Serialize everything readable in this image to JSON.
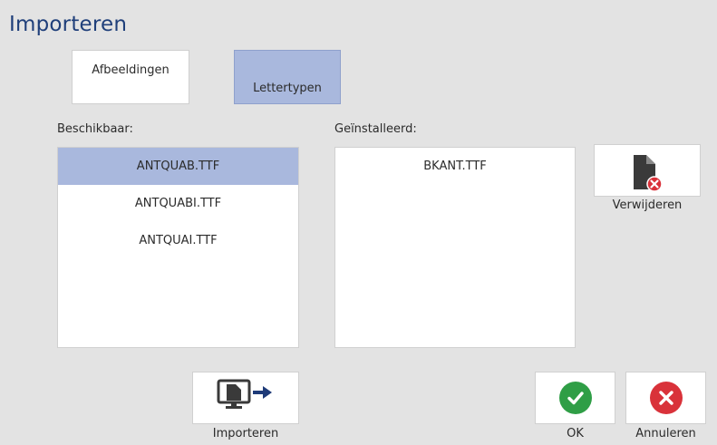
{
  "window": {
    "title": "Importeren"
  },
  "tabs": [
    {
      "label": "Afbeeldingen",
      "selected": false
    },
    {
      "label": "Lettertypen",
      "selected": true
    }
  ],
  "available": {
    "label": "Beschikbaar:",
    "items": [
      "ANTQUAB.TTF",
      "ANTQUABI.TTF",
      "ANTQUAI.TTF"
    ],
    "selected_index": 0
  },
  "installed": {
    "label": "Geïnstalleerd:",
    "items": [
      "BKANT.TTF"
    ]
  },
  "buttons": {
    "remove_label": "Verwijderen",
    "import_label": "Importeren",
    "ok_label": "OK",
    "cancel_label": "Annuleren"
  },
  "icons": {
    "remove": "file-remove-icon",
    "import": "monitor-import-icon",
    "ok": "checkmark-circle-icon",
    "cancel": "close-circle-icon"
  },
  "colors": {
    "title": "#1f3f7a",
    "selection": "#a9b8dd",
    "ok": "#2f9e46",
    "cancel": "#d9323a",
    "icon_dark": "#3a3a3a",
    "import_arrow": "#1e3a78"
  }
}
